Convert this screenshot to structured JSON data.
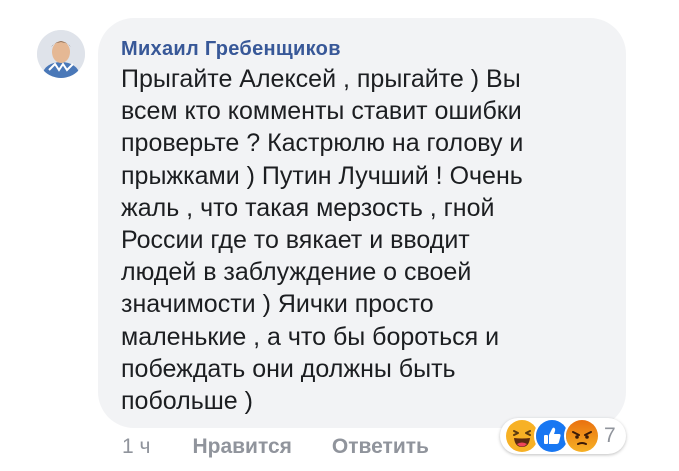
{
  "comment": {
    "author": "Михаил Гребенщиков",
    "text": "Прыгайте Алексей , прыгайте ) Вы\nвсем кто комменты ставит ошибки\nпроверьте ?  Кастрюлю на голову и\nпрыжками ) Путин Лучший !  Очень\nжаль , что такая мерзость , гной\nРоссии где то вякает и вводит\nлюдей в заблуждение о своей\nзначимости ) Яички просто\nмаленькие , а что бы бороться и\nпобеждать они должны быть\nпобольше )"
  },
  "actions": {
    "time": "1 ч",
    "like_label": "Нравится",
    "reply_label": "Ответить"
  },
  "reactions": {
    "icons": [
      "haha-icon",
      "like-icon",
      "angry-icon"
    ],
    "count": "7"
  },
  "colors": {
    "author": "#385898",
    "bubble": "#f2f3f5",
    "meta": "#90949c",
    "like_blue": "#1877f2",
    "haha_yellow": "#f7b125",
    "angry_orange": "#e9710f"
  }
}
